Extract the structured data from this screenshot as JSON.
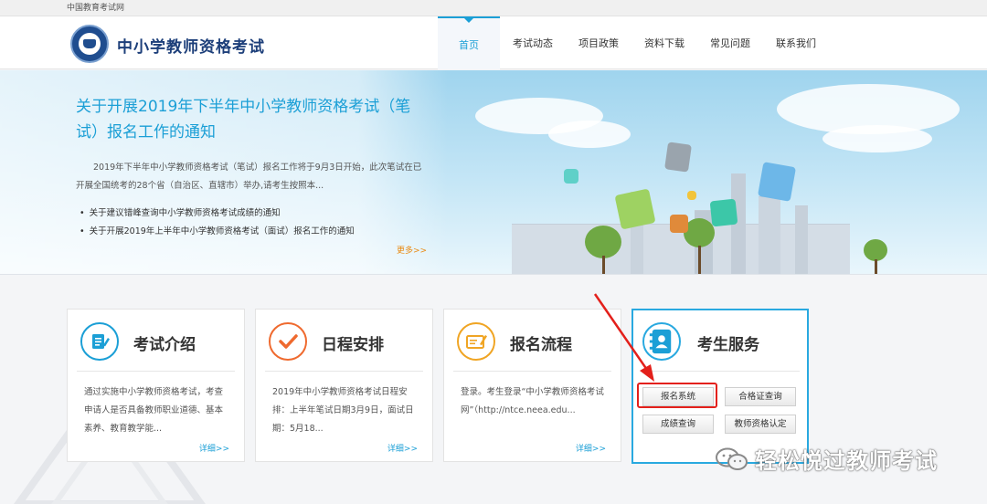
{
  "topbar": {
    "site_name": "中国教育考试网"
  },
  "header": {
    "title": "中小学教师资格考试",
    "nav": [
      {
        "label": "首页",
        "active": true
      },
      {
        "label": "考试动态"
      },
      {
        "label": "项目政策"
      },
      {
        "label": "资料下载"
      },
      {
        "label": "常见问题"
      },
      {
        "label": "联系我们"
      }
    ]
  },
  "banner": {
    "title": "关于开展2019年下半年中小学教师资格考试（笔试）报名工作的通知",
    "desc": "2019年下半年中小学教师资格考试（笔试）报名工作将于9月3日开始，此次笔试在已开展全国统考的28个省（自治区、直辖市）举办,请考生按照本...",
    "links": [
      "关于建议错峰查询中小学教师资格考试成绩的通知",
      "关于开展2019年上半年中小学教师资格考试（面试）报名工作的通知"
    ],
    "more": "更多>>"
  },
  "cards": [
    {
      "title": "考试介绍",
      "text": "通过实施中小学教师资格考试，考查申请人是否具备教师职业道德、基本素养、教育教学能...",
      "more": "详细>>",
      "icon": "document-pen-icon",
      "color": "#1b9fd6"
    },
    {
      "title": "日程安排",
      "text": "2019年中小学教师资格考试日程安排：上半年笔试日期3月9日，面试日期：5月18...",
      "more": "详细>>",
      "icon": "checkmark-icon",
      "color": "#ef6a2f"
    },
    {
      "title": "报名流程",
      "text": "登录。考生登录“中小学教师资格考试网”（http://ntce.neea.edu...",
      "more": "详细>>",
      "icon": "card-pen-icon",
      "color": "#f0a524"
    }
  ],
  "service": {
    "title": "考生服务",
    "icon": "contact-book-icon",
    "buttons": {
      "register": "报名系统",
      "certificate": "合格证查询",
      "score": "成绩查询",
      "qualification": "教师资格认定"
    }
  },
  "watermark": {
    "text": "轻松悦过教师考试",
    "icon": "wechat-icon"
  },
  "colors": {
    "accent": "#1b9fd6",
    "service_border": "#29a9e0",
    "highlight": "#e3201b",
    "more_link": "#e98a13"
  }
}
